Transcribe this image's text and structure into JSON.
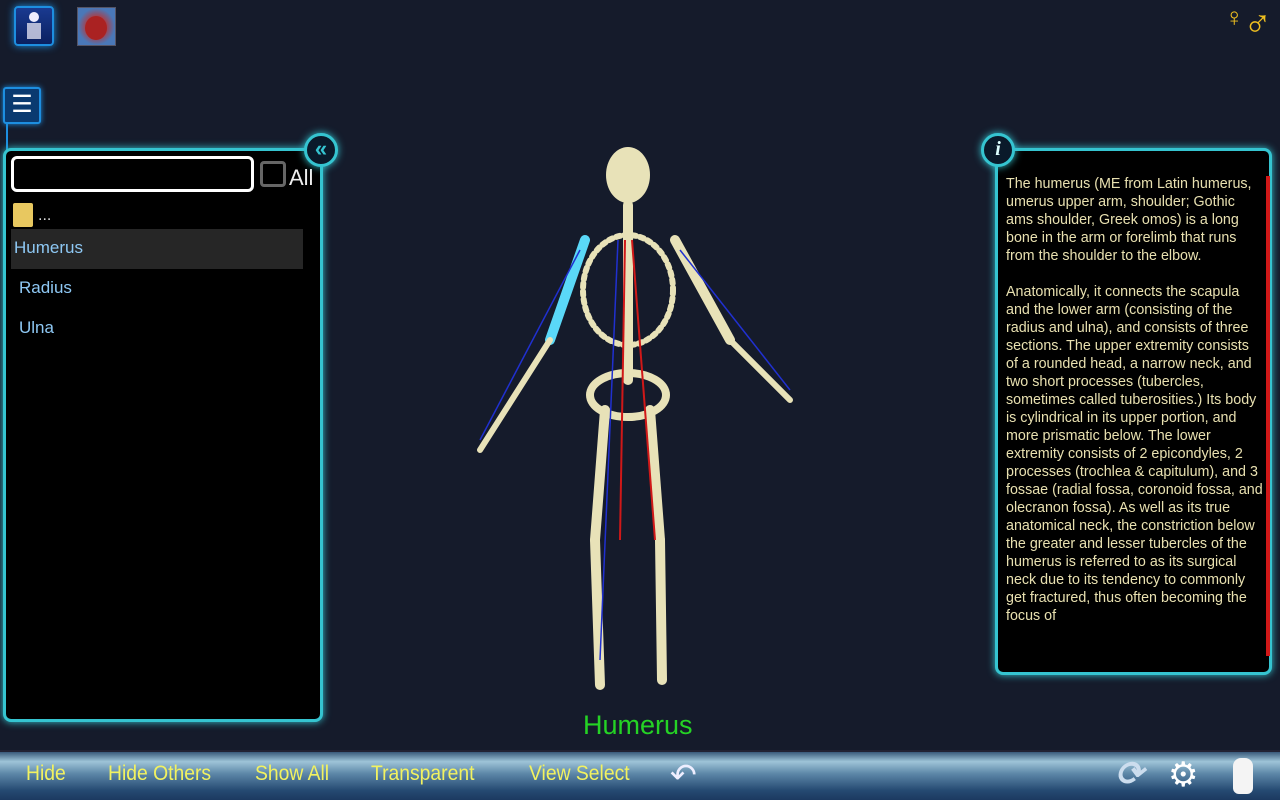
{
  "top": {
    "icons": [
      "skeleton-system-icon",
      "heart-circulatory-icon"
    ],
    "gender_icon": "gender-female-male-icon"
  },
  "left_panel": {
    "search_value": "",
    "all_label": "All",
    "parent_folder": "...",
    "items": [
      "Humerus",
      "Radius",
      "Ulna"
    ],
    "selected": "Humerus"
  },
  "info_panel": {
    "text": "The humerus (ME from Latin humerus, umerus upper arm, shoulder; Gothic ams shoulder, Greek omos) is a long bone in the arm or forelimb that runs from the shoulder to the elbow.\n\nAnatomically, it connects the scapula and the lower arm (consisting of the radius and ulna), and consists of three sections. The upper extremity consists of a rounded head, a narrow neck, and two short processes (tubercles, sometimes called tuberosities.) Its body is cylindrical in its upper portion, and more prismatic below. The lower extremity consists of 2 epicondyles, 2 processes (trochlea & capitulum), and 3 fossae (radial fossa, coronoid fossa, and olecranon fossa). As well as its true anatomical neck, the constriction below the greater and lesser tubercles of the humerus is referred to as its surgical neck due to its tendency to commonly get fractured, thus often becoming the focus of"
  },
  "viewer": {
    "selected_label": "Humerus"
  },
  "toolbar": {
    "hide": "Hide",
    "hide_others": "Hide Others",
    "show_all": "Show All",
    "transparent": "Transparent",
    "view_select": "View Select"
  },
  "colors": {
    "accent": "#35c4d0",
    "toolbar_text": "#f2f260",
    "caption": "#25d325"
  }
}
